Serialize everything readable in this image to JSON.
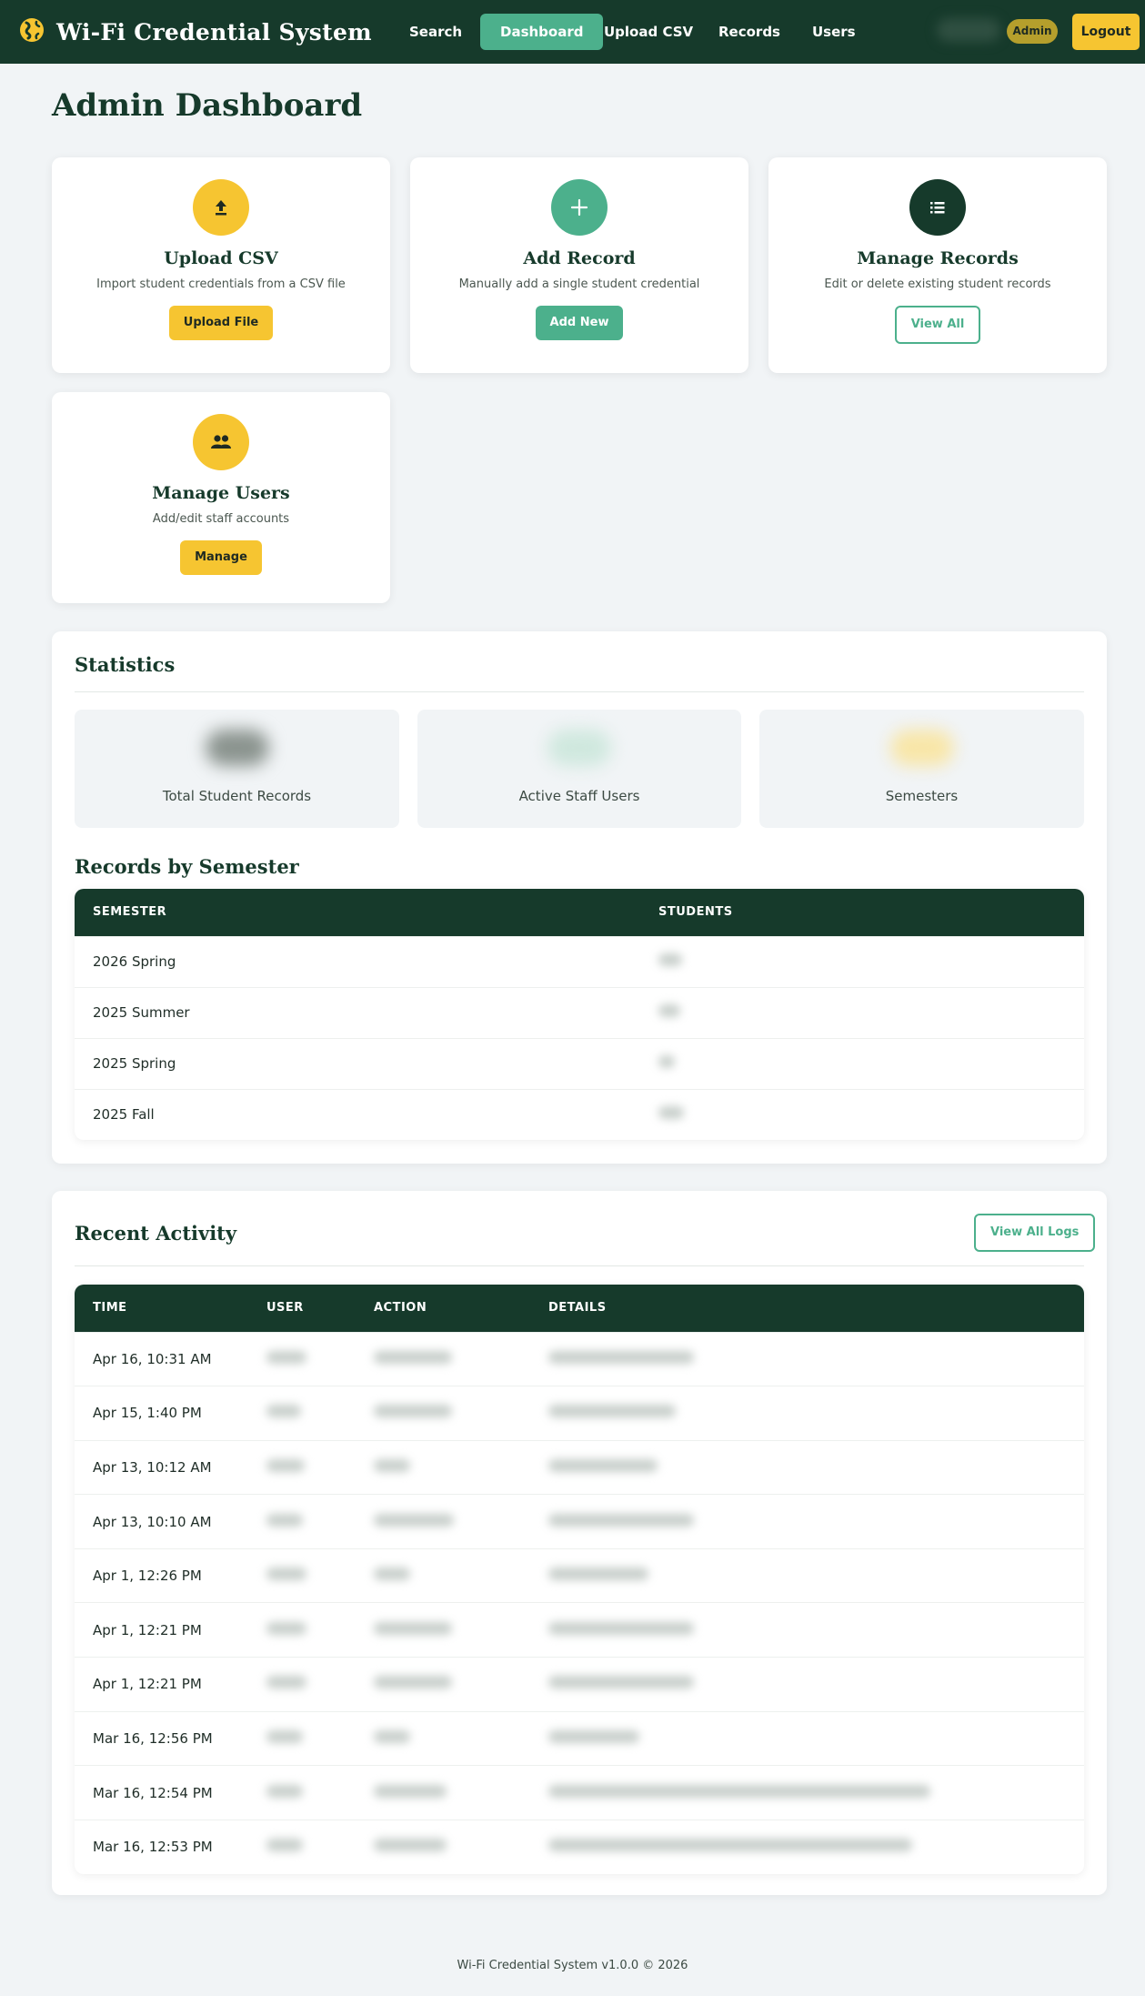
{
  "app": {
    "title": "Wi-Fi Credential System"
  },
  "nav": {
    "items": [
      {
        "label": "Search"
      },
      {
        "label": "Dashboard"
      },
      {
        "label": "Upload CSV"
      },
      {
        "label": "Records"
      },
      {
        "label": "Users"
      }
    ],
    "active": "Dashboard",
    "role_badge": "Admin",
    "logout_label": "Logout"
  },
  "page": {
    "title": "Admin Dashboard"
  },
  "cards": [
    {
      "title": "Upload CSV",
      "description": "Import student credentials from a CSV file",
      "button": "Upload File",
      "icon": "upload-icon",
      "color": "#f6c531"
    },
    {
      "title": "Add Record",
      "description": "Manually add a single student credential",
      "button": "Add New",
      "icon": "plus-icon",
      "color": "#4cb08c"
    },
    {
      "title": "Manage Records",
      "description": "Edit or delete existing student records",
      "button": "View All",
      "icon": "list-icon",
      "color": "#163a2b"
    },
    {
      "title": "Manage Users",
      "description": "Add/edit staff accounts",
      "button": "Manage",
      "icon": "users-icon",
      "color": "#f6c531"
    }
  ],
  "statistics": {
    "title": "Statistics",
    "items": [
      {
        "label": "Total Student Records"
      },
      {
        "label": "Active Staff Users"
      },
      {
        "label": "Semesters"
      }
    ]
  },
  "records_by_semester": {
    "title": "Records by Semester",
    "columns": [
      "SEMESTER",
      "STUDENTS"
    ],
    "rows": [
      {
        "semester": "2026 Spring"
      },
      {
        "semester": "2025 Summer"
      },
      {
        "semester": "2025 Spring"
      },
      {
        "semester": "2025 Fall"
      }
    ]
  },
  "recent_activity": {
    "title": "Recent Activity",
    "view_all_label": "View All Logs",
    "columns": [
      "TIME",
      "USER",
      "ACTION",
      "DETAILS"
    ],
    "rows": [
      {
        "time": "Apr 16, 10:31 AM"
      },
      {
        "time": "Apr 15, 1:40 PM"
      },
      {
        "time": "Apr 13, 10:12 AM"
      },
      {
        "time": "Apr 13, 10:10 AM"
      },
      {
        "time": "Apr 1, 12:26 PM"
      },
      {
        "time": "Apr 1, 12:21 PM"
      },
      {
        "time": "Apr 1, 12:21 PM"
      },
      {
        "time": "Mar 16, 12:56 PM"
      },
      {
        "time": "Mar 16, 12:54 PM"
      },
      {
        "time": "Mar 16, 12:53 PM"
      }
    ]
  },
  "footer": {
    "text": "Wi-Fi Credential System v1.0.0 © 2026"
  },
  "colors": {
    "primary": "#163a2b",
    "accent": "#4cb08c",
    "highlight": "#f6c531",
    "background": "#f1f4f6"
  }
}
